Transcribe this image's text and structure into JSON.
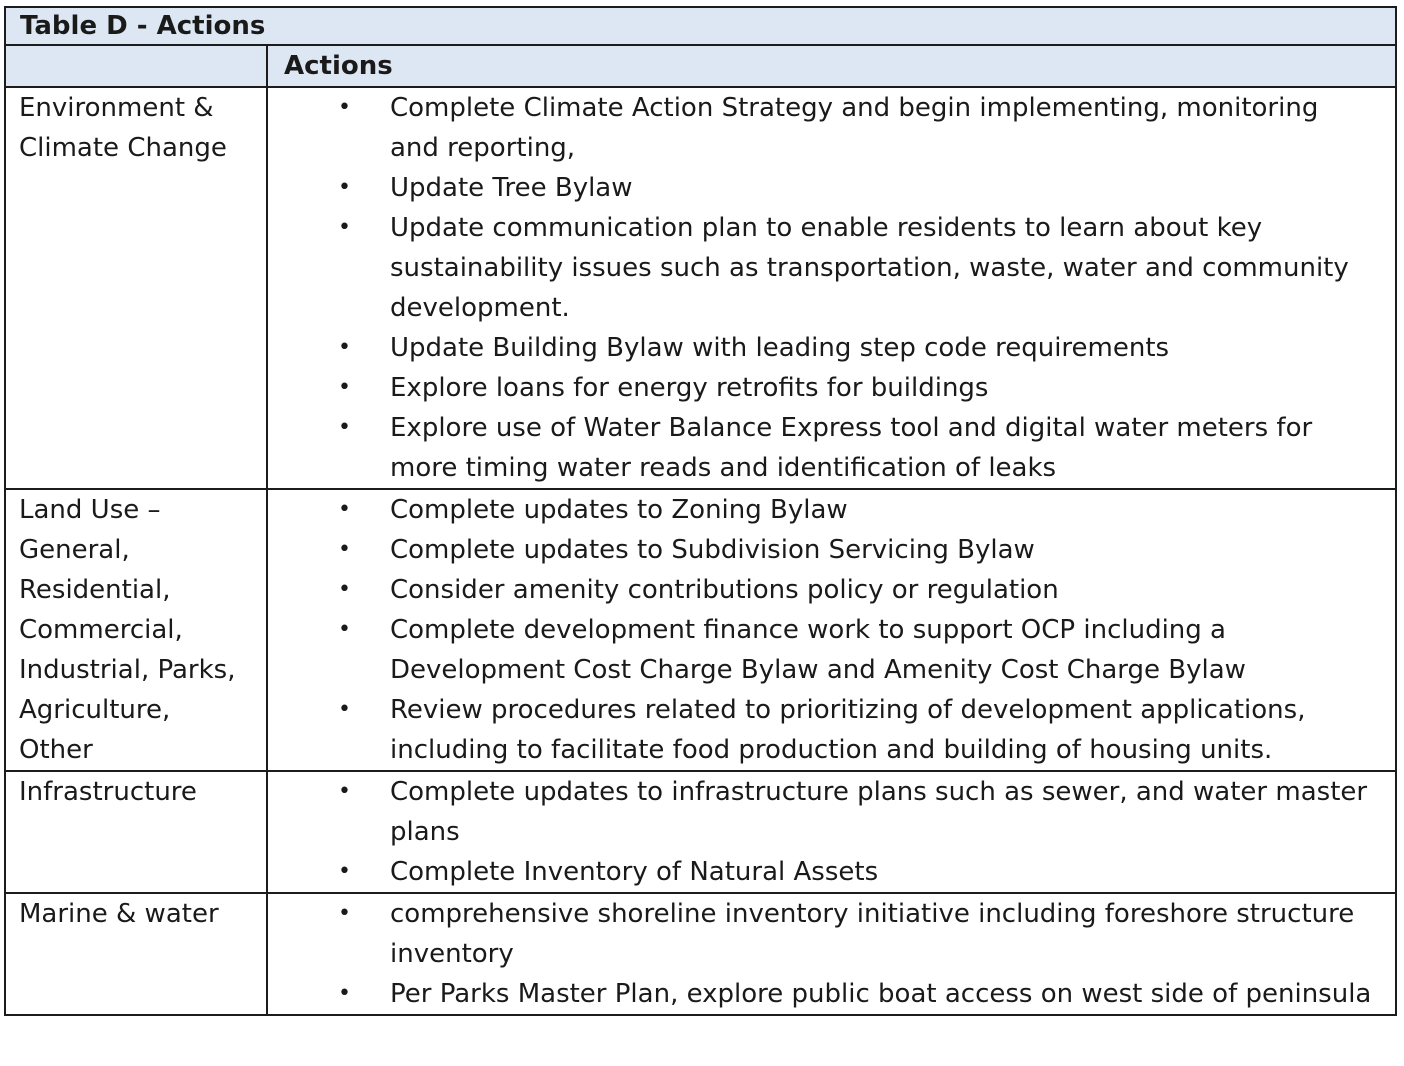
{
  "table": {
    "title": "Table D - Actions",
    "header": {
      "category": "",
      "actions": "Actions"
    },
    "bullet_glyph": "•",
    "rows": [
      {
        "category": "Environment &\nClimate Change",
        "actions": [
          "Complete Climate Action Strategy and begin implementing, monitoring and reporting,",
          "Update Tree Bylaw",
          "Update communication plan to enable residents to learn about key sustainability issues such as transportation, waste, water and community development.",
          "Update Building Bylaw with leading step code requirements",
          "Explore loans for energy retrofits for buildings",
          "Explore use of Water Balance Express tool and digital water meters for more timing water reads and identification of leaks"
        ]
      },
      {
        "category": "Land Use –\nGeneral,\nResidential,\nCommercial,\nIndustrial, Parks,\nAgriculture,\nOther",
        "actions": [
          "Complete updates to Zoning Bylaw",
          "Complete updates to Subdivision Servicing Bylaw",
          "Consider amenity contributions policy or regulation",
          "Complete development finance work to support OCP including a Development Cost Charge Bylaw and Amenity Cost Charge Bylaw",
          "Review procedures related to prioritizing of development applications, including to facilitate food production and building of housing units."
        ]
      },
      {
        "category": "Infrastructure",
        "actions": [
          "Complete updates to infrastructure plans such as sewer, and water master plans",
          "Complete Inventory of Natural Assets"
        ]
      },
      {
        "category": "Marine & water",
        "actions": [
          "comprehensive shoreline inventory initiative including foreshore structure inventory",
          "Per Parks Master Plan, explore public boat access on west side of peninsula"
        ]
      }
    ]
  },
  "colors": {
    "header_background": "#dde7f3",
    "border": "#1c1c1c",
    "text": "#1a1a1a"
  }
}
